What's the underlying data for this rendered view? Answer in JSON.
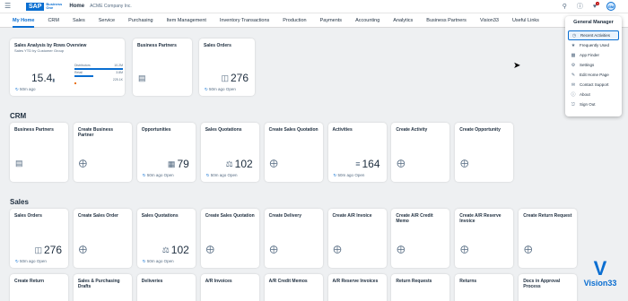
{
  "shell": {
    "logo_text": "SAP",
    "logo_sub": "Business One",
    "home": "Home",
    "company": "ACME Company Inc.",
    "notification_count": "2",
    "avatar_initials": "GM"
  },
  "nav": {
    "tabs": [
      "My Home",
      "CRM",
      "Sales",
      "Service",
      "Purchasing",
      "Item Management",
      "Inventory Transactions",
      "Production",
      "Payments",
      "Accounting",
      "Analytics",
      "Business Partners",
      "Vision33",
      "Useful Links"
    ]
  },
  "home_tiles": [
    {
      "title": "Sales Analysis by Rows Overview",
      "subtitle": "Sales YTD by Customer Group",
      "kpi": "15.4",
      "foot": "50m ago"
    },
    {
      "title": "Business Partners",
      "foot": ""
    },
    {
      "title": "Sales Orders",
      "kpi": "276",
      "foot": "50m ago",
      "status": "Open"
    }
  ],
  "analysis_bars": [
    {
      "label": "Distributors",
      "value": "10.2M",
      "fraction": 1.0
    },
    {
      "label": "Retail",
      "value": "3.8M",
      "fraction": 0.38
    },
    {
      "label": "",
      "value": "225.1K",
      "fraction": 0.03
    }
  ],
  "sections": {
    "crm": "CRM",
    "sales": "Sales"
  },
  "crm_tiles": [
    {
      "title": "Business Partners"
    },
    {
      "title": "Create Business Partner"
    },
    {
      "title": "Opportunities",
      "kpi": "79",
      "foot": "50m ago",
      "status": "Open"
    },
    {
      "title": "Sales Quotations",
      "kpi": "102",
      "foot": "50m ago",
      "status": "Open"
    },
    {
      "title": "Create Sales Quotation"
    },
    {
      "title": "Activities",
      "kpi": "164",
      "foot": "50m ago",
      "status": "Open"
    },
    {
      "title": "Create Activity"
    },
    {
      "title": "Create Opportunity"
    }
  ],
  "sales_tiles": [
    {
      "title": "Sales Orders",
      "kpi": "276",
      "foot": "50m ago",
      "status": "Open"
    },
    {
      "title": "Create Sales Order"
    },
    {
      "title": "Sales Quotations",
      "kpi": "102",
      "foot": "50m ago",
      "status": "Open"
    },
    {
      "title": "Create Sales Quotation"
    },
    {
      "title": "Create Delivery"
    },
    {
      "title": "Create A/R Invoice"
    },
    {
      "title": "Create A/R Credit Memo"
    },
    {
      "title": "Create A/R Reserve Invoice"
    },
    {
      "title": "Create Return Request"
    }
  ],
  "sales_row2": [
    "Create Return",
    "Sales & Purchasing Drafts",
    "Deliveries",
    "A/R Invoices",
    "A/R Credit Memos",
    "A/R Reserve Invoices",
    "Return Requests",
    "Returns",
    "Docs in Approval Process"
  ],
  "dropdown": {
    "title": "General Manager",
    "items": [
      {
        "label": "Recent Activities",
        "icon": "history-icon"
      },
      {
        "label": "Frequently Used",
        "icon": "frequent-icon"
      },
      {
        "label": "App Finder",
        "icon": "app-finder-icon"
      },
      {
        "label": "Settings",
        "icon": "gear-icon"
      },
      {
        "label": "Edit Home Page",
        "icon": "edit-icon"
      },
      {
        "label": "Contact Support",
        "icon": "support-icon"
      },
      {
        "label": "About",
        "icon": "info-icon"
      },
      {
        "label": "Sign Out",
        "icon": "sign-out-icon"
      }
    ]
  },
  "brand": {
    "text": "Vision33"
  },
  "colors": {
    "accent": "#0a6ed1",
    "background": "#eef0f2"
  }
}
